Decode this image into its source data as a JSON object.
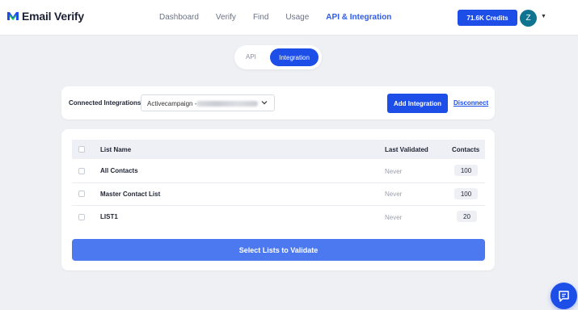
{
  "app": {
    "logo_text": "Email Verify"
  },
  "nav": {
    "items": [
      "Dashboard",
      "Verify",
      "Find",
      "Usage",
      "API & Integration"
    ],
    "active": "API & Integration"
  },
  "header": {
    "credits_label": "71.6K Credits",
    "avatar_letter": "Z"
  },
  "mode_toggle": {
    "api_label": "API",
    "integration_label": "Integration",
    "selected": "Integration"
  },
  "integrations": {
    "label": "Connected Integrations:",
    "selected_value": "Activecampaign -",
    "add_button": "Add Integration",
    "disconnect_link": "Disconnect"
  },
  "lists_table": {
    "columns": [
      "List Name",
      "Last Validated",
      "Contacts"
    ],
    "rows": [
      {
        "name": "All Contacts",
        "last_validated": "Never",
        "contacts": "100"
      },
      {
        "name": "Master Contact List",
        "last_validated": "Never",
        "contacts": "100"
      },
      {
        "name": "LIST1",
        "last_validated": "Never",
        "contacts": "20"
      }
    ]
  },
  "validate_button": "Select Lists to Validate",
  "colors": {
    "primary": "#1d4ee8",
    "validate_button": "#4d79f0",
    "avatar": "#0e7490",
    "background": "#eef0f4"
  },
  "icons": {
    "logo": "shield-check-icon",
    "chat": "chat-bubble-icon",
    "dropdown": "chevron-down-icon"
  }
}
